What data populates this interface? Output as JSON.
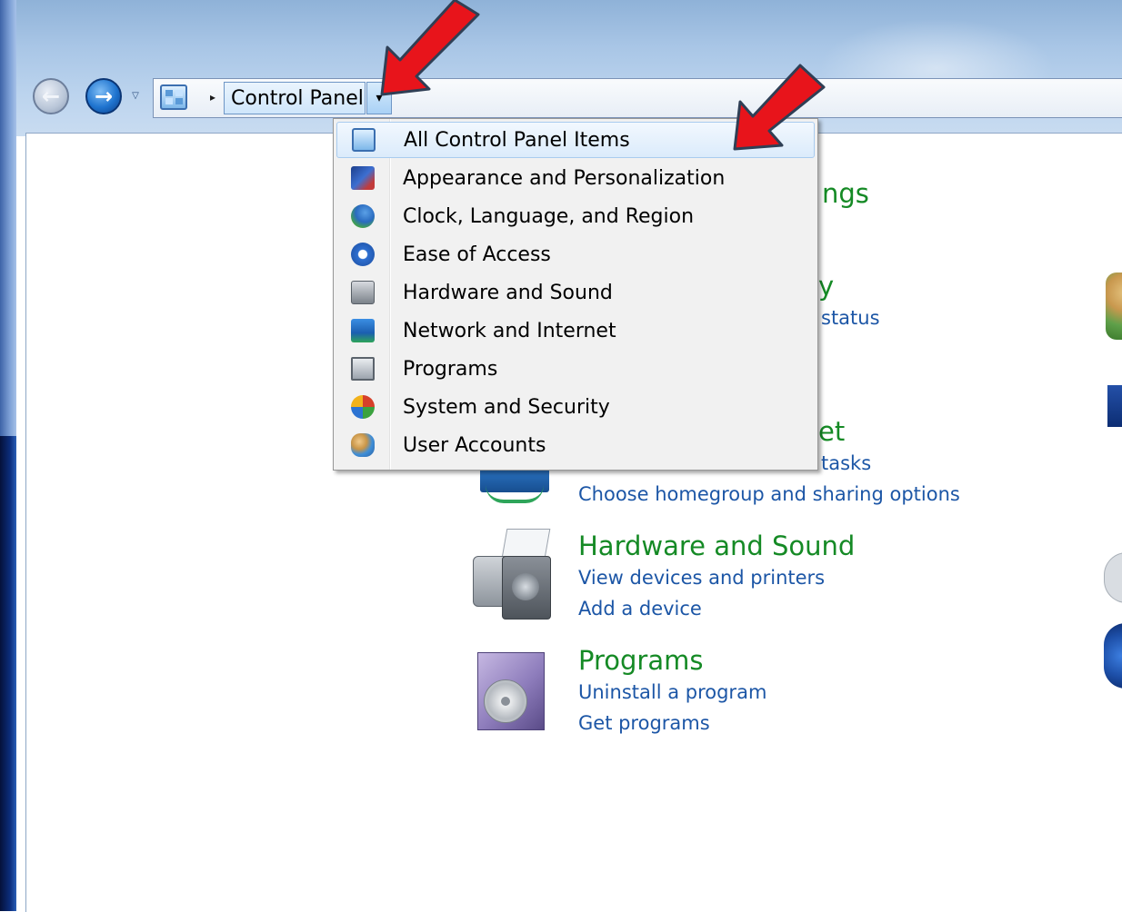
{
  "nav": {
    "back_icon": "back-arrow-icon",
    "forward_icon": "forward-arrow-icon",
    "back_glyph": "←",
    "forward_glyph": "→",
    "recent_glyph": "▽"
  },
  "address_bar": {
    "separator_glyph": "▸",
    "breadcrumb_label": "Control Panel",
    "dropdown_glyph": "▾"
  },
  "menu": {
    "items": [
      {
        "label": "All Control Panel Items",
        "icon": "control-panel-icon",
        "selected": true
      },
      {
        "label": "Appearance and Personalization",
        "icon": "appearance-icon"
      },
      {
        "label": "Clock, Language, and Region",
        "icon": "clock-globe-icon"
      },
      {
        "label": "Ease of Access",
        "icon": "ease-of-access-icon"
      },
      {
        "label": "Hardware and Sound",
        "icon": "hardware-icon"
      },
      {
        "label": "Network and Internet",
        "icon": "network-icon"
      },
      {
        "label": "Programs",
        "icon": "programs-icon"
      },
      {
        "label": "System and Security",
        "icon": "security-icon"
      },
      {
        "label": "User Accounts",
        "icon": "user-accounts-icon"
      }
    ]
  },
  "background": {
    "fragment_ngs": "ngs",
    "fragment_y": "y",
    "fragment_status": "status",
    "fragment_net": "et",
    "fragment_tasks": "tasks",
    "network_link_2": "Choose homegroup and sharing options",
    "hardware": {
      "title": "Hardware and Sound",
      "links": [
        "View devices and printers",
        "Add a device"
      ]
    },
    "programs": {
      "title": "Programs",
      "links": [
        "Uninstall a program",
        "Get programs"
      ]
    }
  },
  "annotations": {
    "arrow_color": "#e8141b",
    "arrow_outline": "#2f3f55"
  },
  "colors": {
    "category_title": "#158a25",
    "link": "#1c56a6",
    "menu_highlight": "#dbebfb"
  }
}
